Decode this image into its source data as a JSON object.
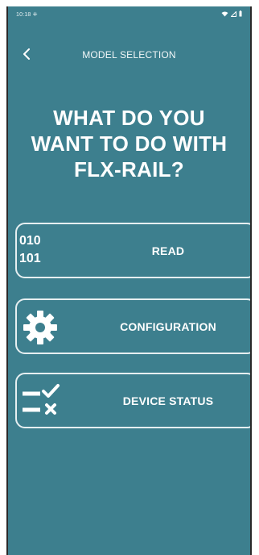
{
  "status_bar": {
    "time": "10:18 ⁜"
  },
  "app_bar": {
    "title": "MODEL SELECTION"
  },
  "question": {
    "line1": "WHAT DO YOU",
    "line2": "WANT TO DO WITH",
    "line3": "FLX-RAIL?"
  },
  "actions": [
    {
      "label": "READ",
      "icon": "binary-icon",
      "icon_text_1": "010",
      "icon_text_2": "101"
    },
    {
      "label": "CONFIGURATION",
      "icon": "gear-icon"
    },
    {
      "label": "DEVICE STATUS",
      "icon": "checklist-icon"
    }
  ],
  "colors": {
    "background": "#3d7f8e",
    "text": "#ffffff",
    "border": "#e6eff1"
  }
}
